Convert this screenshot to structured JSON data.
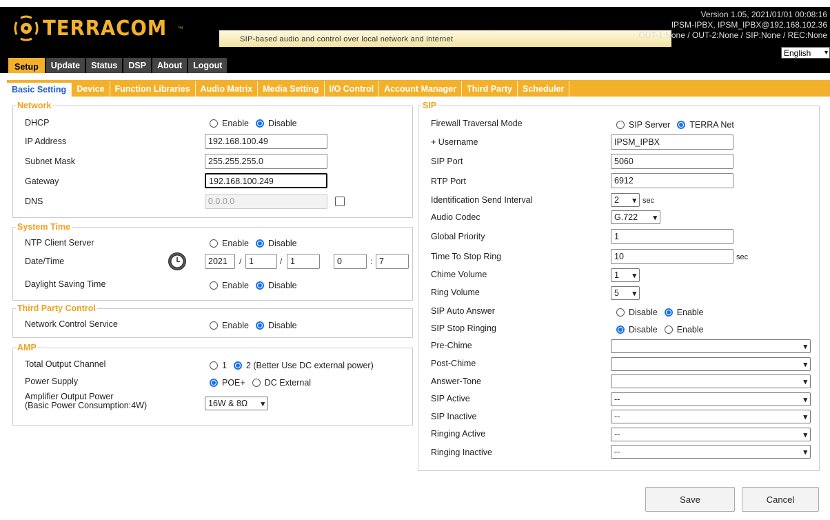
{
  "header": {
    "logo_text": "TERRACOM",
    "logo_tm": "™",
    "tagline": "SIP-based audio and control over local network and internet",
    "version_line1": "Version 1.05, 2021/01/01 00:08:16",
    "version_line2": "IPSM-IPBX, IPSM_IPBX@192.168.102.36",
    "version_line3": "OUT-1:None / OUT-2:None / SIP:None / REC:None",
    "language": "English",
    "brand_color": "#f3b12b"
  },
  "main_tabs": [
    "Setup",
    "Update",
    "Status",
    "DSP",
    "About",
    "Logout"
  ],
  "sub_tabs": [
    "Basic Setting",
    "Device",
    "Function Libraries",
    "Audio Matrix",
    "Media Setting",
    "I/O Control",
    "Account Manager",
    "Third Party",
    "Scheduler"
  ],
  "network": {
    "legend": "Network",
    "dhcp_label": "DHCP",
    "enable": "Enable",
    "disable": "Disable",
    "ip_label": "IP Address",
    "ip_value": "192.168.100.49",
    "mask_label": "Subnet Mask",
    "mask_value": "255.255.255.0",
    "gateway_label": "Gateway",
    "gateway_value": "192.168.100.249",
    "dns_label": "DNS",
    "dns_value": "0.0.0.0"
  },
  "system_time": {
    "legend": "System Time",
    "ntp_label": "NTP Client Server",
    "enable": "Enable",
    "disable": "Disable",
    "datetime_label": "Date/Time",
    "year": "2021",
    "month": "1",
    "day": "1",
    "hour": "0",
    "minute": "7",
    "slash": "/",
    "colon": ":",
    "dst_label": "Daylight Saving Time"
  },
  "third_party": {
    "legend": "Third Party Control",
    "ncs_label": "Network Control Service",
    "enable": "Enable",
    "disable": "Disable"
  },
  "amp": {
    "legend": "AMP",
    "channel_label": "Total Output Channel",
    "channel_opt1": "1",
    "channel_opt2": "2 (Better Use DC external power)",
    "power_label": "Power Supply",
    "power_opt1": "POE+",
    "power_opt2": "DC External",
    "output_label_1": "Amplifier Output Power",
    "output_label_2": "(Basic Power Consumption:4W)",
    "output_value": "16W & 8Ω"
  },
  "sip": {
    "legend": "SIP",
    "firewall_label": "Firewall Traversal Mode",
    "firewall_opt1": "SIP Server",
    "firewall_opt2": "TERRA Net",
    "username_label": "+ Username",
    "username_value": "IPSM_IPBX",
    "sip_port_label": "SIP Port",
    "sip_port_value": "5060",
    "rtp_port_label": "RTP Port",
    "rtp_port_value": "6912",
    "ident_label": "Identification Send Interval",
    "ident_value": "2",
    "sec": "sec",
    "codec_label": "Audio Codec",
    "codec_value": "G.722",
    "priority_label": "Global Priority",
    "priority_value": "1",
    "stop_ring_label": "Time To Stop Ring",
    "stop_ring_value": "10",
    "chime_label": "Chime Volume",
    "chime_value": "1",
    "ring_vol_label": "Ring Volume",
    "ring_vol_value": "5",
    "auto_answer_label": "SIP Auto Answer",
    "stop_ringing_label": "SIP Stop Ringing",
    "disable": "Disable",
    "enable": "Enable",
    "pre_chime_label": "Pre-Chime",
    "post_chime_label": "Post-Chime",
    "answer_tone_label": "Answer-Tone",
    "sip_active_label": "SIP Active",
    "sip_inactive_label": "SIP Inactive",
    "ringing_active_label": "Ringing Active",
    "ringing_inactive_label": "Ringing Inactive",
    "dash": "--",
    "empty": ""
  },
  "buttons": {
    "save": "Save",
    "cancel": "Cancel"
  }
}
